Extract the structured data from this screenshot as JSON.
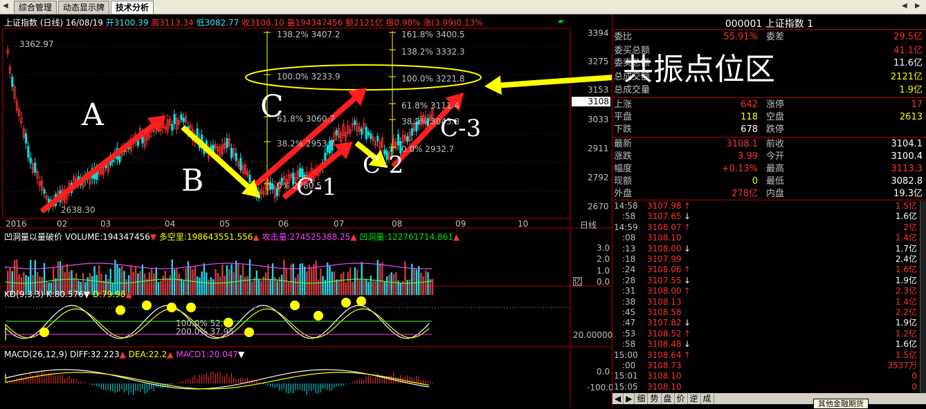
{
  "tabs": [
    "综合管理",
    "动态显示牌",
    "技术分析"
  ],
  "info": {
    "name": "上证指数 (日线) 16/08/19",
    "open": "开3100.39",
    "high": "高3113.34",
    "low": "低3082.77",
    "close": "收3108.10",
    "volume": "量194347456",
    "amount": "额2121亿",
    "amplitude": "振0.98%",
    "change": "涨(3.99)0.13%"
  },
  "price_axis": [
    "3394",
    "3275",
    "3153",
    "3033",
    "2911",
    "2792",
    "2670"
  ],
  "price_tag": "3108",
  "date_axis": [
    "2016",
    "02",
    "03",
    "04",
    "05",
    "06",
    "07",
    "08",
    "09",
    "10"
  ],
  "period_label": "日线",
  "chart_marks": {
    "high_label": "3362.97",
    "low_label": "2638.30"
  },
  "fib_left": [
    "138.2% 3407.2",
    "100.0% 3233.9",
    "61.8% 3060.7",
    "38.2% 2953.7",
    "0% 2780.5"
  ],
  "fib_right": [
    "161.8% 3400.5",
    "138.2% 3332.3",
    "100.0% 3221.8",
    "61.8% 3111.4",
    "38.2% 3043.8",
    "0.0% 2932.7"
  ],
  "annotations": {
    "wave_a": "A",
    "wave_b": "B",
    "wave_c": "C",
    "wave_c1": "C-1",
    "wave_c2": "C-2",
    "wave_c3": "C-3",
    "zone": "共振点位区"
  },
  "volume_panel": {
    "title": "凹洞量以量破价",
    "volume": "VOLUME:194347456",
    "multi": "多空里:198643551.556",
    "attack": "攻击量:274525388.25",
    "hole": "凹洞量:122761714.861",
    "axis": [
      "3.0",
      "2.0",
      "1.0",
      "0.0"
    ],
    "unit": "亿"
  },
  "kd_panel": {
    "title": "KD(9,3,3)",
    "k": "K:80.576",
    "d": "D:79.98",
    "lbl1": "100.0% 52.",
    "lbl2": "200.0% 37.95",
    "axis": "20.00000"
  },
  "macd_panel": {
    "title": "MACD(26,12,9)",
    "diff": "DIFF:32.223",
    "dea": "DEA:22.2",
    "macd": "MACD1:20.047",
    "axis": [
      "0.0",
      "-100.0"
    ]
  },
  "right_panel": {
    "title": "000001 上证指数 1",
    "weibi_label": "委比",
    "weibi": "55.91%",
    "weicha_label": "委差",
    "weicha": "29.5亿",
    "maiwei_label": "委买总额",
    "maiwei": "41.1亿",
    "maiwei2_label": "委卖总额",
    "maiwei2": "11.6亿",
    "total_amt_label": "总成交额",
    "total_amt": "2121亿",
    "total_vol_label": "总成交量",
    "total_vol": "1.9亿",
    "up_label": "上涨",
    "up": "642",
    "limitup_label": "涨停",
    "limitup": "17",
    "flat_label": "平盘",
    "flat": "118",
    "empty_label": "空盘",
    "empty": "2613",
    "down_label": "下跌",
    "down": "678",
    "limitdown_label": "跌停",
    "limitdown": "",
    "last_label": "最新",
    "last": "3108.1",
    "prevclose_label": "前收",
    "prevclose": "3104.1",
    "chg_label": "涨跌",
    "chg": "3.99",
    "open_label": "今开",
    "open": "3100.4",
    "amp_label": "幅度",
    "amp": "+0.13%",
    "high_label": "最高",
    "high": "3113.3",
    "cur_label": "现额",
    "cur": "0",
    "low_label": "最低",
    "low": "3082.8",
    "outer_label": "外盘",
    "outer": "278亿",
    "inner_label": "内盘",
    "inner": "19.3亿"
  },
  "ticks": [
    {
      "t": "14:58",
      "p": "3107.98",
      "d": "↑",
      "v": "1.5亿",
      "pc": "red",
      "vc": "red"
    },
    {
      "t": ":58",
      "p": "3107.65",
      "d": "↓",
      "v": "1.6亿",
      "pc": "red",
      "vc": "white"
    },
    {
      "t": "14:59",
      "p": "3108.07",
      "d": "↑",
      "v": "2亿",
      "pc": "red",
      "vc": "red"
    },
    {
      "t": ":08",
      "p": "3108.10",
      "d": "",
      "v": "1.4亿",
      "pc": "red",
      "vc": "red"
    },
    {
      "t": ":13",
      "p": "3108.00",
      "d": "↓",
      "v": "1.7亿",
      "pc": "red",
      "vc": "white"
    },
    {
      "t": ":18",
      "p": "3107.99",
      "d": "",
      "v": "2.4亿",
      "pc": "red",
      "vc": "white"
    },
    {
      "t": ":24",
      "p": "3108.06",
      "d": "↑",
      "v": "1.6亿",
      "pc": "red",
      "vc": "red"
    },
    {
      "t": ":28",
      "p": "3107.55",
      "d": "↓",
      "v": "1.9亿",
      "pc": "red",
      "vc": "white"
    },
    {
      "t": ":31",
      "p": "3108.00",
      "d": "↑",
      "v": "2.3亿",
      "pc": "red",
      "vc": "red"
    },
    {
      "t": ":38",
      "p": "3108.13",
      "d": "",
      "v": "1.4亿",
      "pc": "red",
      "vc": "red"
    },
    {
      "t": ":45",
      "p": "3108.58",
      "d": "",
      "v": "2.2亿",
      "pc": "red",
      "vc": "red"
    },
    {
      "t": ":47",
      "p": "3107.82",
      "d": "↓",
      "v": "1.9亿",
      "pc": "red",
      "vc": "white"
    },
    {
      "t": ":53",
      "p": "3108.52",
      "d": "↑",
      "v": "1.2亿",
      "pc": "red",
      "vc": "red"
    },
    {
      "t": ":58",
      "p": "3108.48",
      "d": "↓",
      "v": "1.6亿",
      "pc": "red",
      "vc": "white"
    },
    {
      "t": "15:00",
      "p": "3108.64",
      "d": "↑",
      "v": "1.5亿",
      "pc": "red",
      "vc": "red"
    },
    {
      "t": ":00",
      "p": "3108.73",
      "d": "",
      "v": "3537万",
      "pc": "red",
      "vc": "red"
    },
    {
      "t": "15:01",
      "p": "3108.10",
      "d": "",
      "v": "0",
      "pc": "red",
      "vc": "red"
    },
    {
      "t": "15:05",
      "p": "3108.10",
      "d": "",
      "v": "0",
      "pc": "red",
      "vc": "red"
    }
  ],
  "bottom_tabs": [
    "细",
    "势",
    "盘",
    "价",
    "逆",
    "成"
  ],
  "bottom_tooltip": "其他金融期货",
  "colors": {
    "up": "#ff3232",
    "down": "#00e4e4",
    "bg": "#000000",
    "accent": "#ffff00"
  }
}
